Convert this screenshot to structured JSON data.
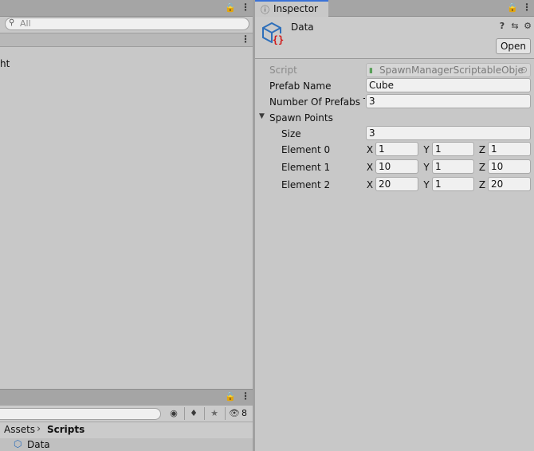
{
  "hierarchy": {
    "search_placeholder": "All",
    "partial_item_text": "ht"
  },
  "inspector": {
    "tab_label": "Inspector",
    "object_name": "Data",
    "open_button": "Open",
    "fields": {
      "script": {
        "label": "Script",
        "value": "SpawnManagerScriptableObje"
      },
      "prefab_name": {
        "label": "Prefab Name",
        "value": "Cube"
      },
      "number_of_prefabs": {
        "label": "Number Of Prefabs To Create",
        "value": "3"
      }
    },
    "spawn_points": {
      "label": "Spawn Points",
      "size_label": "Size",
      "size_value": "3",
      "axis_x": "X",
      "axis_y": "Y",
      "axis_z": "Z",
      "elements": [
        {
          "label": "Element 0",
          "x": "1",
          "y": "1",
          "z": "1"
        },
        {
          "label": "Element 1",
          "x": "10",
          "y": "1",
          "z": "10"
        },
        {
          "label": "Element 2",
          "x": "20",
          "y": "1",
          "z": "20"
        }
      ]
    }
  },
  "project": {
    "hidden_count": "8",
    "breadcrumb_root": "Assets",
    "breadcrumb_current": "Scripts",
    "asset_item": "Data"
  }
}
